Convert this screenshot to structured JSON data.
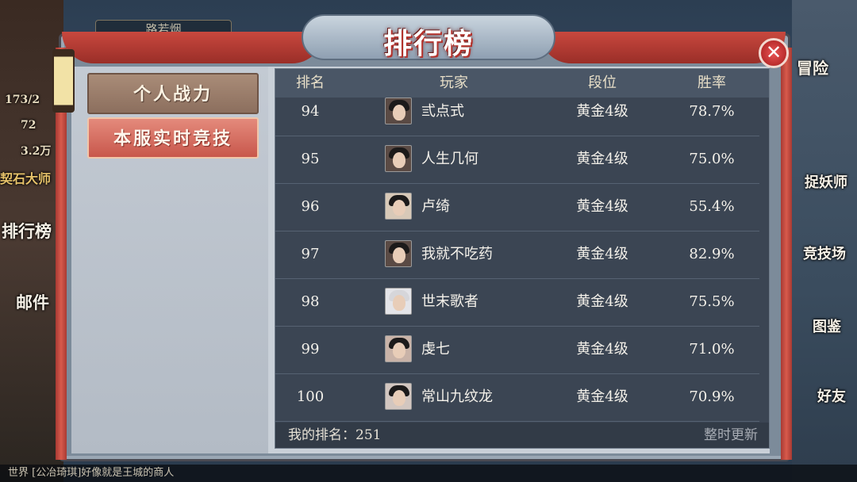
{
  "hud": {
    "player_name": "路若烟",
    "stamina": "173/2",
    "gems": "72",
    "coins": "3.2万",
    "title_badge": "契石大师"
  },
  "left_menu": {
    "ranking": "排行榜",
    "mail": "邮件"
  },
  "right_menu": {
    "adventure": "冒险",
    "exorcist": "捉妖师",
    "arena": "竞技场",
    "codex": "图鉴",
    "friends": "好友"
  },
  "chat": {
    "line": "世界 [公冶琦琪]好像就是王城的商人"
  },
  "panel": {
    "title": "排行榜",
    "close": "✕"
  },
  "tabs": [
    {
      "label": "个人战力"
    },
    {
      "label": "本服实时竞技"
    }
  ],
  "table": {
    "headers": {
      "rank": "排名",
      "player": "玩家",
      "tier": "段位",
      "win_rate": "胜率"
    },
    "rows": [
      {
        "rank": "94",
        "name": "弎点式",
        "tier": "黄金4级",
        "win_rate": "78.7%"
      },
      {
        "rank": "95",
        "name": "人生几何",
        "tier": "黄金4级",
        "win_rate": "75.0%"
      },
      {
        "rank": "96",
        "name": "卢绮",
        "tier": "黄金4级",
        "win_rate": "55.4%"
      },
      {
        "rank": "97",
        "name": "我就不吃药",
        "tier": "黄金4级",
        "win_rate": "82.9%"
      },
      {
        "rank": "98",
        "name": "世末歌者",
        "tier": "黄金4级",
        "win_rate": "75.5%"
      },
      {
        "rank": "99",
        "name": "虔七",
        "tier": "黄金4级",
        "win_rate": "71.0%"
      },
      {
        "rank": "100",
        "name": "常山九纹龙",
        "tier": "黄金4级",
        "win_rate": "70.9%"
      }
    ]
  },
  "footer": {
    "my_rank": "我的排名：251",
    "refresh_note": "整时更新"
  }
}
